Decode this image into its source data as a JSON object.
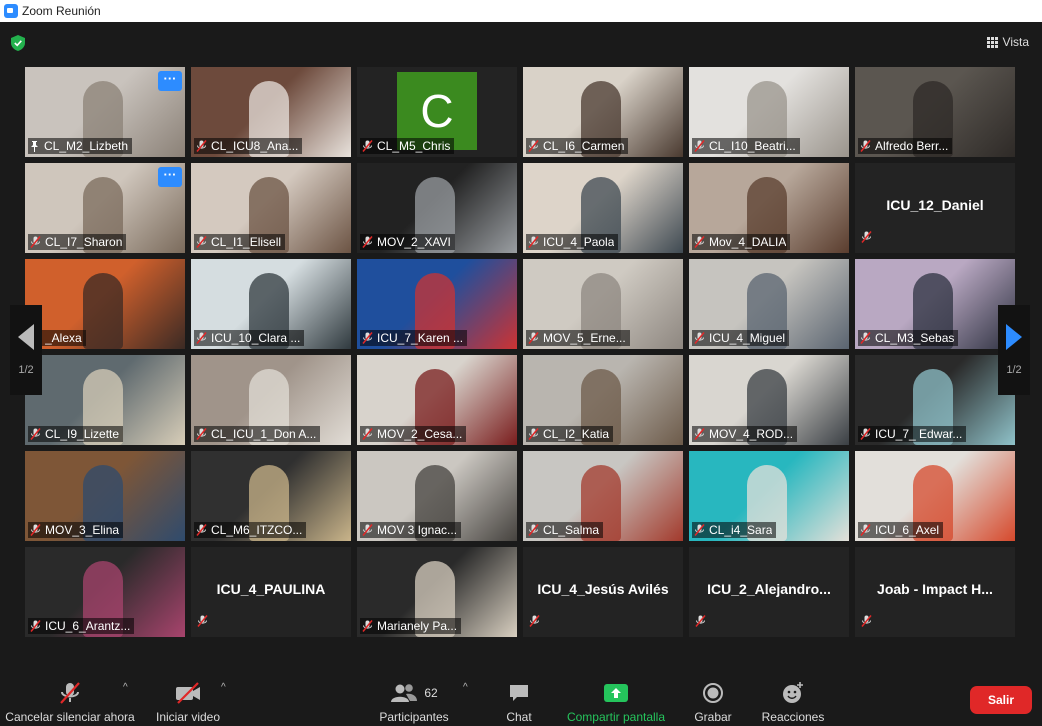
{
  "window": {
    "title": "Zoom Reunión"
  },
  "header": {
    "view_label": "Vista"
  },
  "paging": {
    "indicator_left": "1/2",
    "indicator_right": "1/2"
  },
  "colors": {
    "accent": "#2d8cff",
    "active_speaker": "#e6e85a",
    "leave": "#e02828",
    "share_green": "#25c45c",
    "avatar_c": "#3b8a1f"
  },
  "participants": [
    {
      "name": "CL_M2_Lizbeth",
      "pinned": true,
      "more": true,
      "video": true
    },
    {
      "name": "CL_ICU8_Ana...",
      "video": true
    },
    {
      "name": "CL_M5_Chris",
      "avatar_letter": "C"
    },
    {
      "name": "CL_I6_Carmen",
      "video": true
    },
    {
      "name": "CL_I10_Beatri...",
      "video": true
    },
    {
      "name": "Alfredo Berr...",
      "video": true
    },
    {
      "name": "CL_I7_Sharon",
      "more": true,
      "video": true
    },
    {
      "name": "CL_I1_Elisell",
      "video": true
    },
    {
      "name": "MOV_2_XAVI",
      "video": true
    },
    {
      "name": "ICU_4_Paola",
      "video": true
    },
    {
      "name": "Mov_4_DALIA",
      "video": true
    },
    {
      "name": "ICU_12_Daniel",
      "video": false
    },
    {
      "name": "_Alexa",
      "video": true
    },
    {
      "name": "ICU_10_Clara ...",
      "video": true
    },
    {
      "name": "ICU_7_Karen ...",
      "video": true
    },
    {
      "name": "MOV_5_Erne...",
      "video": true
    },
    {
      "name": "ICU_4_Miguel",
      "video": true
    },
    {
      "name": "CL_M3_Sebas",
      "video": true
    },
    {
      "name": "CL_I9_Lizette",
      "video": true
    },
    {
      "name": "CL_ICU_1_Don A...",
      "video": true
    },
    {
      "name": "MOV_2_Cesa...",
      "video": true
    },
    {
      "name": "CL_I2_Katia",
      "video": true
    },
    {
      "name": "MOV_4_ROD...",
      "video": true
    },
    {
      "name": "ICU_7_ Edwar...",
      "video": true
    },
    {
      "name": "MOV_3_Elina",
      "video": true
    },
    {
      "name": "CL_M6_ITZCO...",
      "video": true
    },
    {
      "name": "MOV 3 Ignac...",
      "video": true
    },
    {
      "name": "CL_Salma",
      "video": true
    },
    {
      "name": "CL_i4_Sara",
      "video": true
    },
    {
      "name": "ICU_6_Axel",
      "video": true
    },
    {
      "name": "ICU_6_Arantz...",
      "video": true
    },
    {
      "name": "ICU_4_PAULINA",
      "video": false
    },
    {
      "name": "Marianely Pa...",
      "video": true
    },
    {
      "name": "ICU_4_Jesús Avilés",
      "video": false
    },
    {
      "name": "ICU_2_Alejandro...",
      "video": false
    },
    {
      "name": "Joab - Impact H...",
      "video": false
    }
  ],
  "toolbar": {
    "unmute_label": "Cancelar silenciar ahora",
    "start_video_label": "Iniciar video",
    "participants_label": "Participantes",
    "participants_count": "62",
    "chat_label": "Chat",
    "share_label": "Compartir pantalla",
    "record_label": "Grabar",
    "reactions_label": "Reacciones",
    "leave_label": "Salir"
  }
}
